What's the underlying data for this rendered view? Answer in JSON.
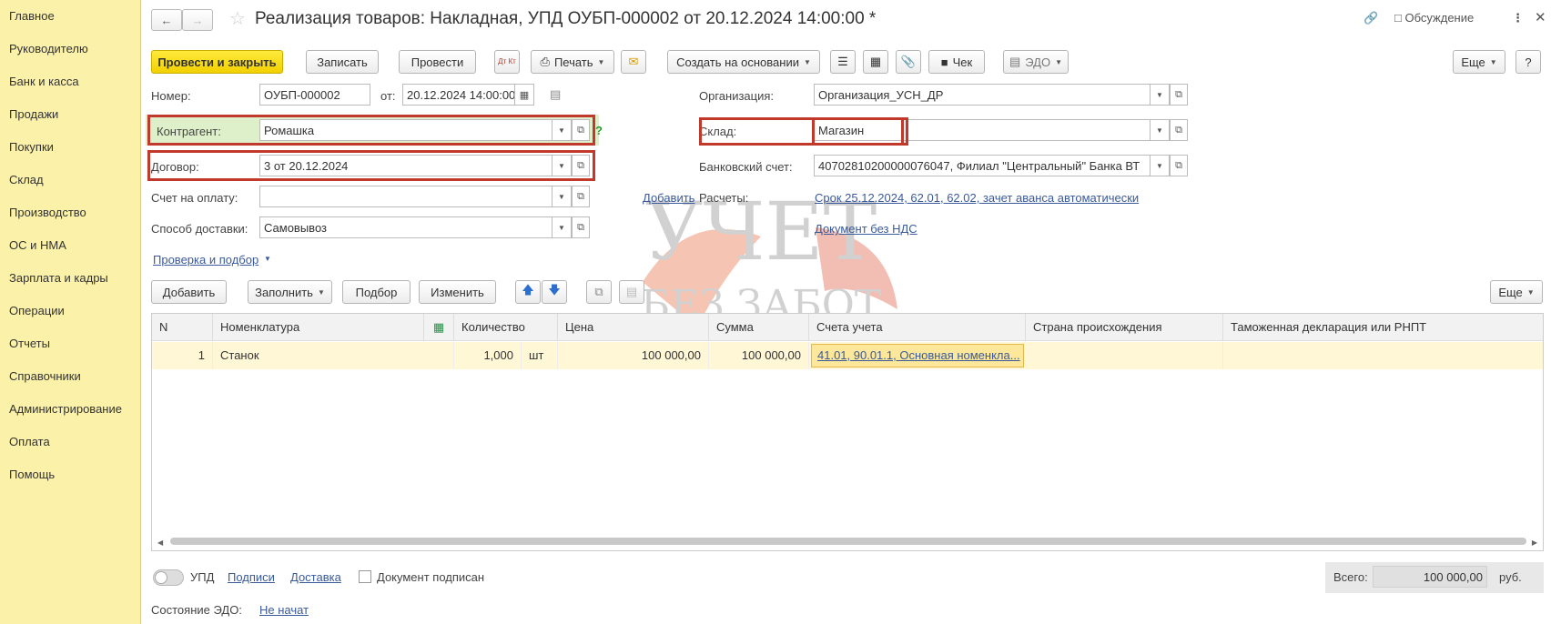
{
  "sidebar": {
    "items": [
      {
        "label": "Главное"
      },
      {
        "label": "Руководителю"
      },
      {
        "label": "Банк и касса"
      },
      {
        "label": "Продажи"
      },
      {
        "label": "Покупки"
      },
      {
        "label": "Склад"
      },
      {
        "label": "Производство"
      },
      {
        "label": "ОС и НМА"
      },
      {
        "label": "Зарплата и кадры"
      },
      {
        "label": "Операции"
      },
      {
        "label": "Отчеты"
      },
      {
        "label": "Справочники"
      },
      {
        "label": "Администрирование"
      },
      {
        "label": "Оплата"
      },
      {
        "label": "Помощь"
      }
    ]
  },
  "header": {
    "title": "Реализация товаров: Накладная, УПД ОУБП-000002 от 20.12.2024 14:00:00 *",
    "discussion": "Обсуждение"
  },
  "toolbar": {
    "post_close": "Провести и закрыть",
    "save": "Записать",
    "post": "Провести",
    "dtkt": "Дт Кт",
    "print": "Печать",
    "create_based": "Создать на основании",
    "check": "Чек",
    "edo": "ЭДО",
    "more": "Еще",
    "help": "?"
  },
  "form": {
    "number_label": "Номер:",
    "number_value": "ОУБП-000002",
    "from_label": "от:",
    "date_value": "20.12.2024 14:00:00",
    "org_label": "Организация:",
    "org_value": "Организация_УСН_ДР",
    "counterparty_label": "Контрагент:",
    "counterparty_value": "Ромашка",
    "counterparty_help": "?",
    "warehouse_label": "Склад:",
    "warehouse_value": "Магазин",
    "contract_label": "Договор:",
    "contract_value": "3 от 20.12.2024",
    "bank_label": "Банковский счет:",
    "bank_value": "40702810200000076047, Филиал \"Центральный\" Банка ВТ",
    "invoice_label": "Счет на оплату:",
    "invoice_value": "",
    "add_link": "Добавить",
    "settlements_label": "Расчеты:",
    "settlements_link": "Срок 25.12.2024, 62.01, 62.02, зачет аванса автоматически",
    "delivery_label": "Способ доставки:",
    "delivery_value": "Самовывоз",
    "vat_link": "Документ без НДС",
    "check_link": "Проверка и подбор"
  },
  "table_toolbar": {
    "add": "Добавить",
    "fill": "Заполнить",
    "selection": "Подбор",
    "change": "Изменить",
    "more": "Еще"
  },
  "table": {
    "headers": [
      "N",
      "Номенклатура",
      "Количество",
      "Цена",
      "Сумма",
      "Счета учета",
      "Страна происхождения",
      "Таможенная декларация или РНПТ"
    ],
    "rows": [
      {
        "n": "1",
        "item": "Станок",
        "qty": "1,000",
        "unit": "шт",
        "price": "100 000,00",
        "sum": "100 000,00",
        "accounts": "41.01, 90.01.1, Основная номенкла...",
        "country": "",
        "customs": ""
      }
    ]
  },
  "footer": {
    "upd": "УПД",
    "signatures": "Подписи",
    "delivery": "Доставка",
    "signed": "Документ подписан",
    "total_label": "Всего:",
    "total_value": "100 000,00",
    "currency": "руб.",
    "edo_state_label": "Состояние ЭДО:",
    "edo_state_value": "Не начат"
  },
  "watermark": {
    "line1": "УЧЕТ",
    "line2": "БЕЗ ЗАБОТ"
  }
}
